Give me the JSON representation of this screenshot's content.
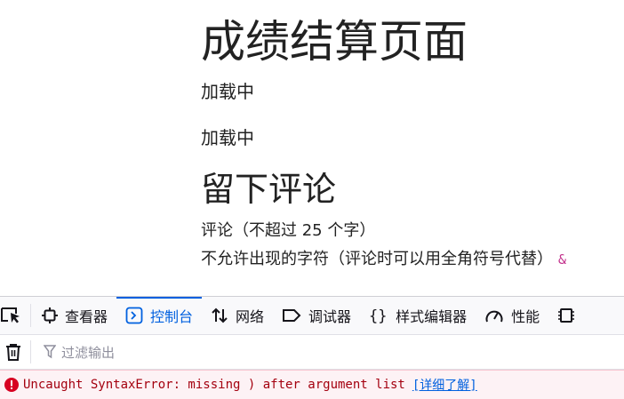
{
  "page": {
    "title": "成绩结算页面",
    "loading_1": "加载中",
    "loading_2": "加载中",
    "comment_heading": "留下评论",
    "comment_hint": "评论（不超过 25 个字）",
    "forbidden_chars": "不允许出现的字符（评论时可以用全角符号代替）",
    "forbidden_symbol": "&"
  },
  "devtools": {
    "tabs": [
      {
        "label": "查看器",
        "icon": "inspector-icon"
      },
      {
        "label": "控制台",
        "icon": "console-icon",
        "active": true
      },
      {
        "label": "网络",
        "icon": "network-icon"
      },
      {
        "label": "调试器",
        "icon": "debugger-icon"
      },
      {
        "label": "样式编辑器",
        "icon": "style-editor-icon"
      },
      {
        "label": "性能",
        "icon": "performance-icon"
      }
    ],
    "filter_placeholder": "过滤输出",
    "error": {
      "message": "Uncaught SyntaxError: missing ) after argument list",
      "learn_more": "[详细了解]"
    },
    "colors": {
      "active_tab": "#0060df",
      "error_text": "#a4000f",
      "error_bg": "#fdf2f5",
      "error_icon": "#d70022"
    }
  }
}
